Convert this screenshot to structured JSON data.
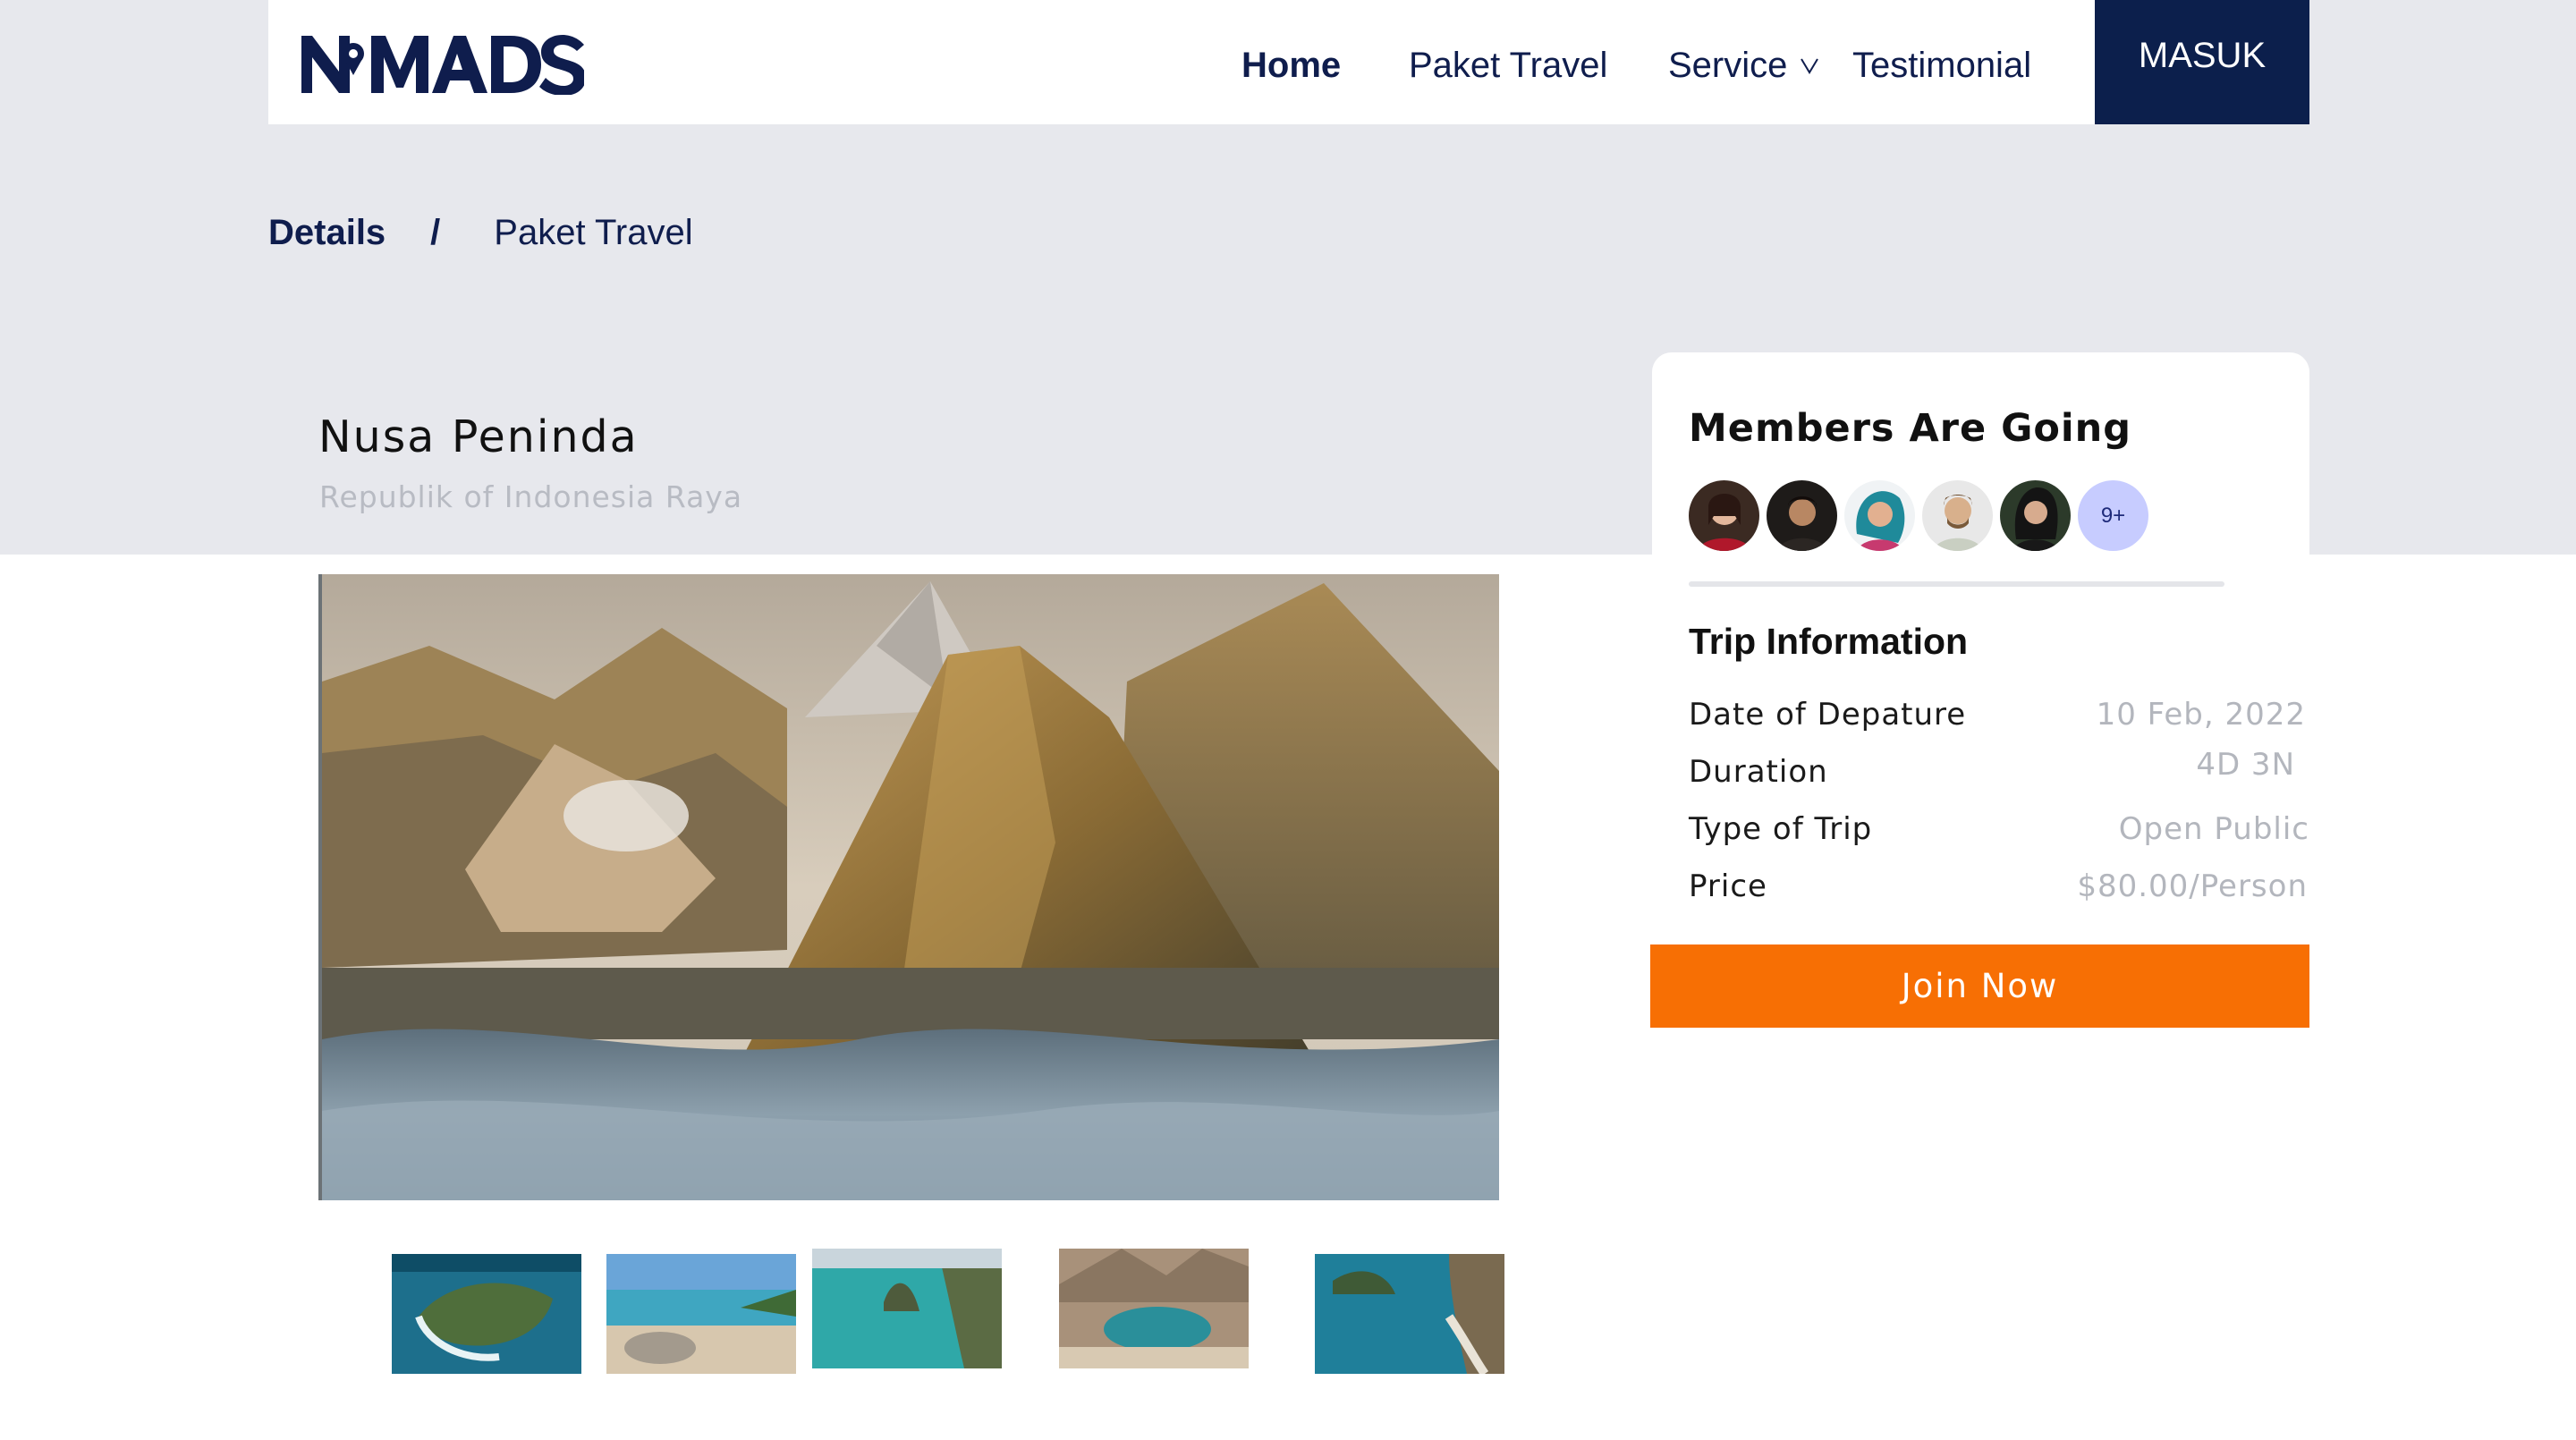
{
  "brand": {
    "logo_text": "NOMADS"
  },
  "nav": {
    "items": [
      {
        "label": "Home",
        "active": true
      },
      {
        "label": "Paket Travel"
      },
      {
        "label": "Service"
      },
      {
        "label": "Testimonial"
      }
    ],
    "login_label": "MASUK"
  },
  "breadcrumb": {
    "current": "Details",
    "separator": "/",
    "parent": "Paket Travel"
  },
  "destination": {
    "title": "Nusa Peninda",
    "subtitle": "Republik of Indonesia Raya"
  },
  "members": {
    "title": "Members Are Going",
    "avatars": [
      "member-1",
      "member-2",
      "member-3",
      "member-4",
      "member-5"
    ],
    "more_label": "9+"
  },
  "trip": {
    "heading": "Trip Information",
    "rows": [
      {
        "label": "Date of Depature",
        "value": "10 Feb, 2022"
      },
      {
        "label": "Duration",
        "value": "4D 3N"
      },
      {
        "label": "Type of Trip",
        "value": "Open Public"
      },
      {
        "label": "Price",
        "value": "$80.00/Person"
      }
    ],
    "cta": "Join Now"
  },
  "colors": {
    "navy": "#0c1f4c",
    "accent": "#f76f04",
    "hero_bg": "#e7e8ed",
    "muted_text": "#b3b6bd",
    "avatar_more_bg": "#c7ccff"
  }
}
